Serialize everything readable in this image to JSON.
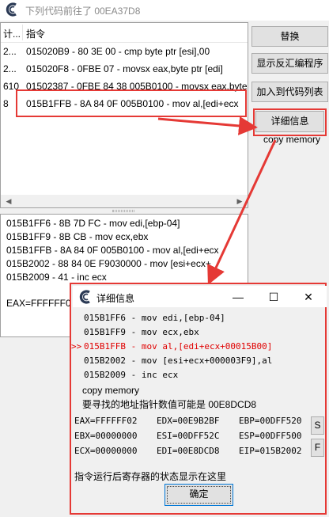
{
  "main_window": {
    "title": "下列代码前往了 00EA37D8"
  },
  "list": {
    "headers": [
      "计...",
      "指令"
    ],
    "rows": [
      {
        "count": "2...",
        "instruction": "015020B9 - 80 3E 00 - cmp byte ptr [esi],00"
      },
      {
        "count": "2...",
        "instruction": "015020F8 - 0FBE 07  - movsx eax,byte ptr [edi]"
      },
      {
        "count": "610",
        "instruction": "01502387 - 0FBE 84 38 005B0100  - movsx eax,byte"
      },
      {
        "count": "8",
        "instruction": "015B1FFB - 8A 84 0F 005B0100  - mov al,[edi+ecx"
      }
    ]
  },
  "buttons": {
    "replace": "替换",
    "show_disassembler": "显示反汇编程序",
    "add_to_codelist": "加入到代码列表",
    "more_info": "详细信息"
  },
  "copy_memory_label": "copy memory",
  "disasm": [
    "015B1FF6 - 8B 7D FC  - mov edi,[ebp-04]",
    "015B1FF9 - 8B CB  - mov ecx,ebx",
    "015B1FFB - 8A 84 0F 005B0100  - mov al,[edi+ecx",
    "015B2002 - 88 84 0E F9030000  - mov [esi+ecx+",
    "015B2009 - 41 - inc ecx"
  ],
  "main_register_partial": "EAX=FFFFFF02",
  "detail_dialog": {
    "title": "详细信息",
    "lines": [
      {
        "marker": "",
        "text": "015B1FF6 - mov edi,[ebp-04]",
        "highlight": false
      },
      {
        "marker": "",
        "text": "015B1FF9 - mov ecx,ebx",
        "highlight": false
      },
      {
        "marker": ">>",
        "text": "015B1FFB - mov al,[edi+ecx+00015B00]",
        "highlight": true
      },
      {
        "marker": "",
        "text": "015B2002 - mov [esi+ecx+000003F9],al",
        "highlight": false
      },
      {
        "marker": "",
        "text": "015B2009 - inc ecx",
        "highlight": false
      }
    ],
    "copy_memory": "copy memory",
    "pointer_hint": "要寻找的地址指针数值可能是 00E8DCD8",
    "registers": [
      [
        "EAX=FFFFFF02",
        "EDX=00E9B2BF",
        "EBP=00DFF520"
      ],
      [
        "EBX=00000000",
        "ESI=00DFF52C",
        "ESP=00DFF500"
      ],
      [
        "ECX=00000000",
        "EDI=00E8DCD8",
        "EIP=015B2002"
      ]
    ],
    "s_button": "S",
    "f_button": "F",
    "footer_text": "指令运行后寄存器的状态显示在这里",
    "ok_button": "确定",
    "controls": {
      "minimize": "—",
      "maximize": "☐",
      "close": "✕"
    }
  },
  "colors": {
    "annotation_red": "#e53935",
    "highlight_red": "#e00000",
    "selection_border": "#e53935"
  },
  "icons": {
    "app_icon": "cheat-engine-icon",
    "scroll_left": "arrow-left-icon",
    "scroll_right": "arrow-right-icon"
  }
}
